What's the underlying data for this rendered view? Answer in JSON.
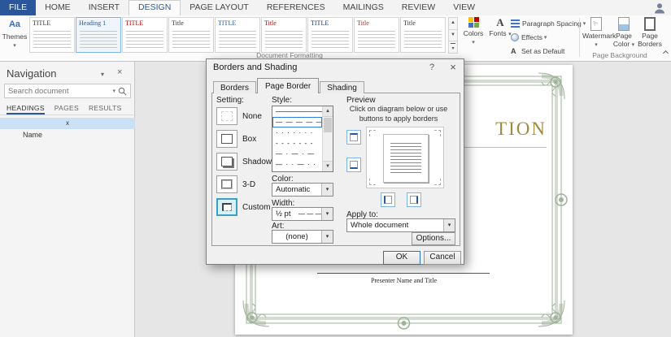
{
  "icons": {
    "chevron_down": "▾",
    "scroll_up": "▲",
    "scroll_down": "▼",
    "gallery_more": "▾",
    "close": "×",
    "help": "?"
  },
  "titlebar": {
    "tabs": [
      {
        "label": "FILE",
        "file": true
      },
      {
        "label": "HOME"
      },
      {
        "label": "INSERT"
      },
      {
        "label": "DESIGN",
        "active": true
      },
      {
        "label": "PAGE LAYOUT"
      },
      {
        "label": "REFERENCES"
      },
      {
        "label": "MAILINGS"
      },
      {
        "label": "REVIEW"
      },
      {
        "label": "VIEW"
      }
    ]
  },
  "ribbon": {
    "themes": {
      "label": "Themes"
    },
    "style_gallery": {
      "items": [
        {
          "title": "TITLE",
          "color": "#333333"
        },
        {
          "title": "Heading 1",
          "color": "#2b579a",
          "selected": true
        },
        {
          "title": "TITLE",
          "color": "#c00000"
        },
        {
          "title": "Title",
          "color": "#333333"
        },
        {
          "title": "TITLE",
          "color": "#2b579a"
        },
        {
          "title": "Title",
          "color": "#c00000"
        },
        {
          "title": "TITLE",
          "color": "#1f3864"
        },
        {
          "title": "Title",
          "color": "#943634"
        },
        {
          "title": "Title",
          "color": "#333333"
        }
      ]
    },
    "colors": {
      "label": "Colors"
    },
    "fonts": {
      "label": "Fonts"
    },
    "paragraph_spacing": {
      "label": "Paragraph Spacing"
    },
    "effects": {
      "label": "Effects"
    },
    "set_as_default": {
      "label": "Set as Default"
    },
    "watermark": {
      "label": "Watermark"
    },
    "page_color": {
      "label": "Page Color"
    },
    "page_borders": {
      "label": "Page Borders"
    },
    "group_labels": {
      "document_formatting": "Document Formatting",
      "page_background": "Page Background"
    }
  },
  "navigation": {
    "title": "Navigation",
    "search_placeholder": "Search document",
    "tabs": [
      {
        "label": "HEADINGS",
        "active": true
      },
      {
        "label": "PAGES"
      },
      {
        "label": "RESULTS"
      }
    ],
    "items": [
      {
        "label": "x",
        "selected": true
      },
      {
        "label": "Name"
      }
    ]
  },
  "document_page": {
    "visible_title_fragment": "TION",
    "presenter_line": "Presenter Name and Title"
  },
  "dialog": {
    "title": "Borders and Shading",
    "tabs": [
      {
        "label": "Borders"
      },
      {
        "label": "Page Border",
        "active": true
      },
      {
        "label": "Shading"
      }
    ],
    "setting": {
      "label": "Setting:",
      "options": [
        {
          "label": "None",
          "type": "none"
        },
        {
          "label": "Box",
          "type": "box"
        },
        {
          "label": "Shadow",
          "type": "shadow"
        },
        {
          "label": "3-D",
          "type": "threed"
        },
        {
          "label": "Custom",
          "type": "custom",
          "selected": true
        }
      ]
    },
    "style": {
      "label": "Style:",
      "options": [
        {
          "glyph": "──────────────"
        },
        {
          "glyph": "—  —  —  —  —",
          "selected": true
        },
        {
          "glyph": "·  ·  ·  ·  ·  ·  ·"
        },
        {
          "glyph": "-  -  -  -  -  -  -"
        },
        {
          "glyph": "—  ·  —  ·  —"
        },
        {
          "glyph": "—  ·  ·  —  ·  ·"
        }
      ]
    },
    "color": {
      "label": "Color:",
      "value": "Automatic"
    },
    "width": {
      "label": "Width:",
      "value": "½ pt",
      "sample": "— — — —"
    },
    "art": {
      "label": "Art:",
      "value": "(none)"
    },
    "preview": {
      "label": "Preview",
      "hint": "Click on diagram below or use buttons to apply borders"
    },
    "apply_to": {
      "label": "Apply to:",
      "value": "Whole document"
    },
    "buttons": {
      "options": "Options...",
      "ok": "OK",
      "cancel": "Cancel"
    }
  },
  "colors": {
    "accent": "#2b579a",
    "file_tab": "#2b579a",
    "selection": "#cbe1f5",
    "certificate_green": "#9fb29a",
    "certificate_gold": "#a18a3e"
  }
}
